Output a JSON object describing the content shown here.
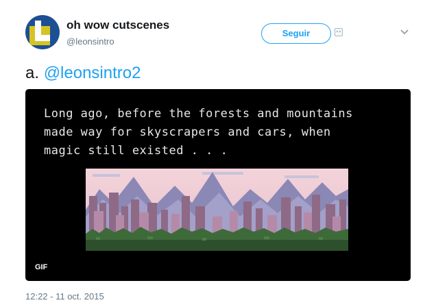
{
  "user": {
    "name": "oh wow cutscenes",
    "handle": "@leonsintro",
    "avatar_colors": {
      "background": "#1d4f93",
      "accent": "#d6c423",
      "letter": "#ffffff"
    }
  },
  "actions": {
    "follow_label": "Seguir",
    "bot_icon": "bot-label-icon",
    "menu_icon": "chevron-down-icon"
  },
  "tweet": {
    "prefix": "a.",
    "mention": "@leonsintro2"
  },
  "media": {
    "caption_lines": [
      "Long ago, before the forests and mountains",
      "made way for skyscrapers and cars, when",
      "magic still existed . . ."
    ],
    "badge": "GIF"
  },
  "timestamp": "12:22 - 11 oct. 2015",
  "colors": {
    "accent": "#1da1f2",
    "text": "#14171a",
    "muted": "#657786",
    "media_bg": "#000000"
  }
}
